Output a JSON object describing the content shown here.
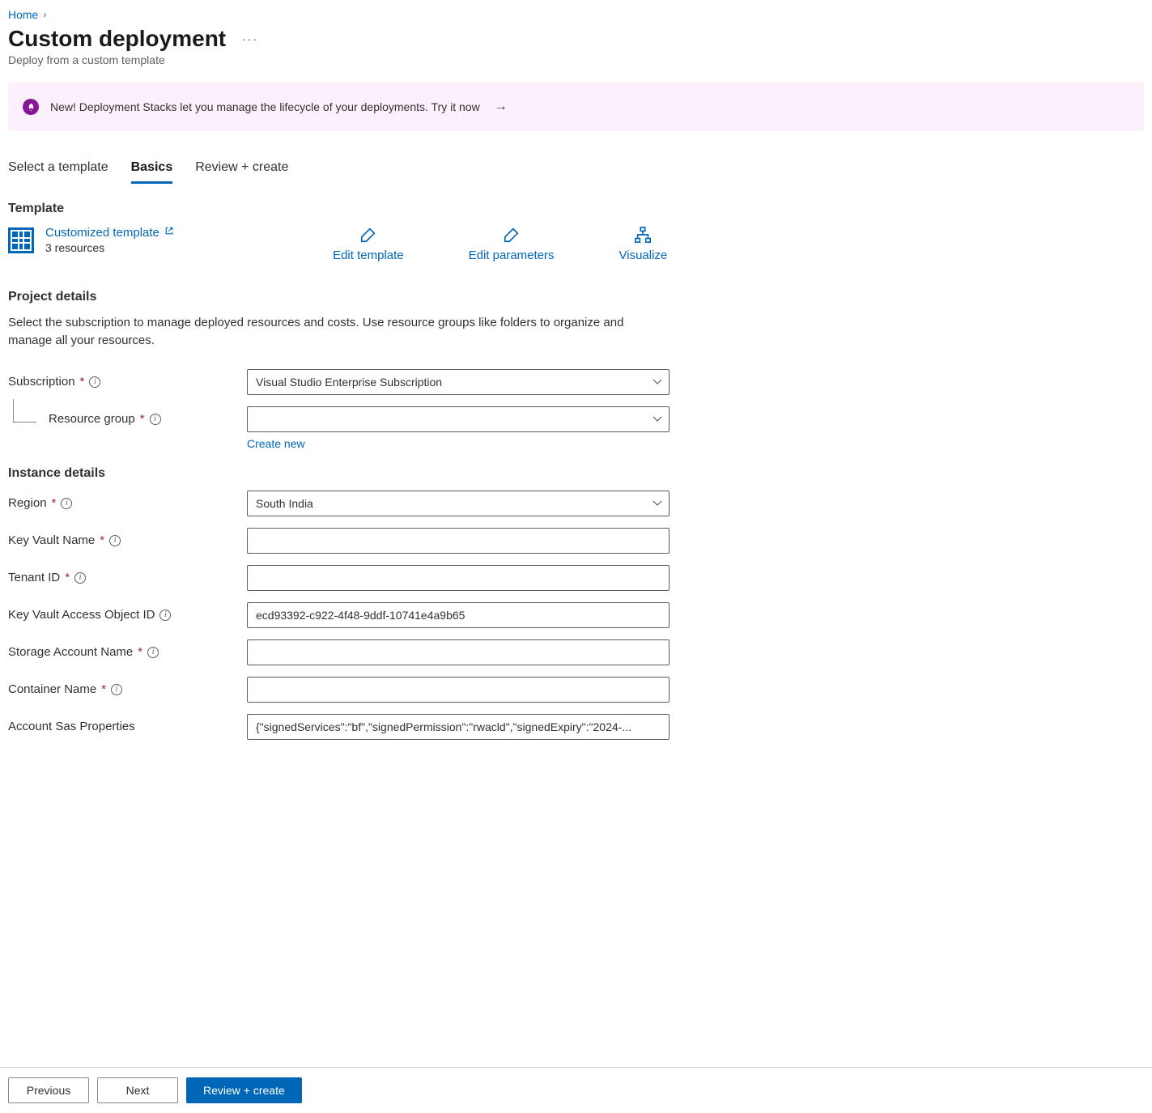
{
  "breadcrumb": {
    "home": "Home"
  },
  "header": {
    "title": "Custom deployment",
    "subtitle": "Deploy from a custom template"
  },
  "banner": {
    "text": "New! Deployment Stacks let you manage the lifecycle of your deployments. Try it now"
  },
  "tabs": {
    "select_template": "Select a template",
    "basics": "Basics",
    "review_create": "Review + create"
  },
  "template": {
    "section": "Template",
    "link": "Customized template",
    "resources": "3 resources",
    "edit_template": "Edit template",
    "edit_parameters": "Edit parameters",
    "visualize": "Visualize"
  },
  "project": {
    "section": "Project details",
    "description": "Select the subscription to manage deployed resources and costs. Use resource groups like folders to organize and manage all your resources.",
    "subscription_label": "Subscription",
    "subscription_value": "Visual Studio Enterprise Subscription",
    "resource_group_label": "Resource group",
    "resource_group_value": "",
    "create_new": "Create new"
  },
  "instance": {
    "section": "Instance details",
    "region_label": "Region",
    "region_value": "South India",
    "kv_name_label": "Key Vault Name",
    "kv_name_value": "",
    "tenant_label": "Tenant ID",
    "tenant_value": "",
    "kv_obj_label": "Key Vault Access Object ID",
    "kv_obj_value": "ecd93392-c922-4f48-9ddf-10741e4a9b65",
    "storage_label": "Storage Account Name",
    "storage_value": "",
    "container_label": "Container Name",
    "container_value": "",
    "sas_label": "Account Sas Properties",
    "sas_value": "{\"signedServices\":\"bf\",\"signedPermission\":\"rwacld\",\"signedExpiry\":\"2024-..."
  },
  "footer": {
    "previous": "Previous",
    "next": "Next",
    "review_create": "Review + create"
  }
}
